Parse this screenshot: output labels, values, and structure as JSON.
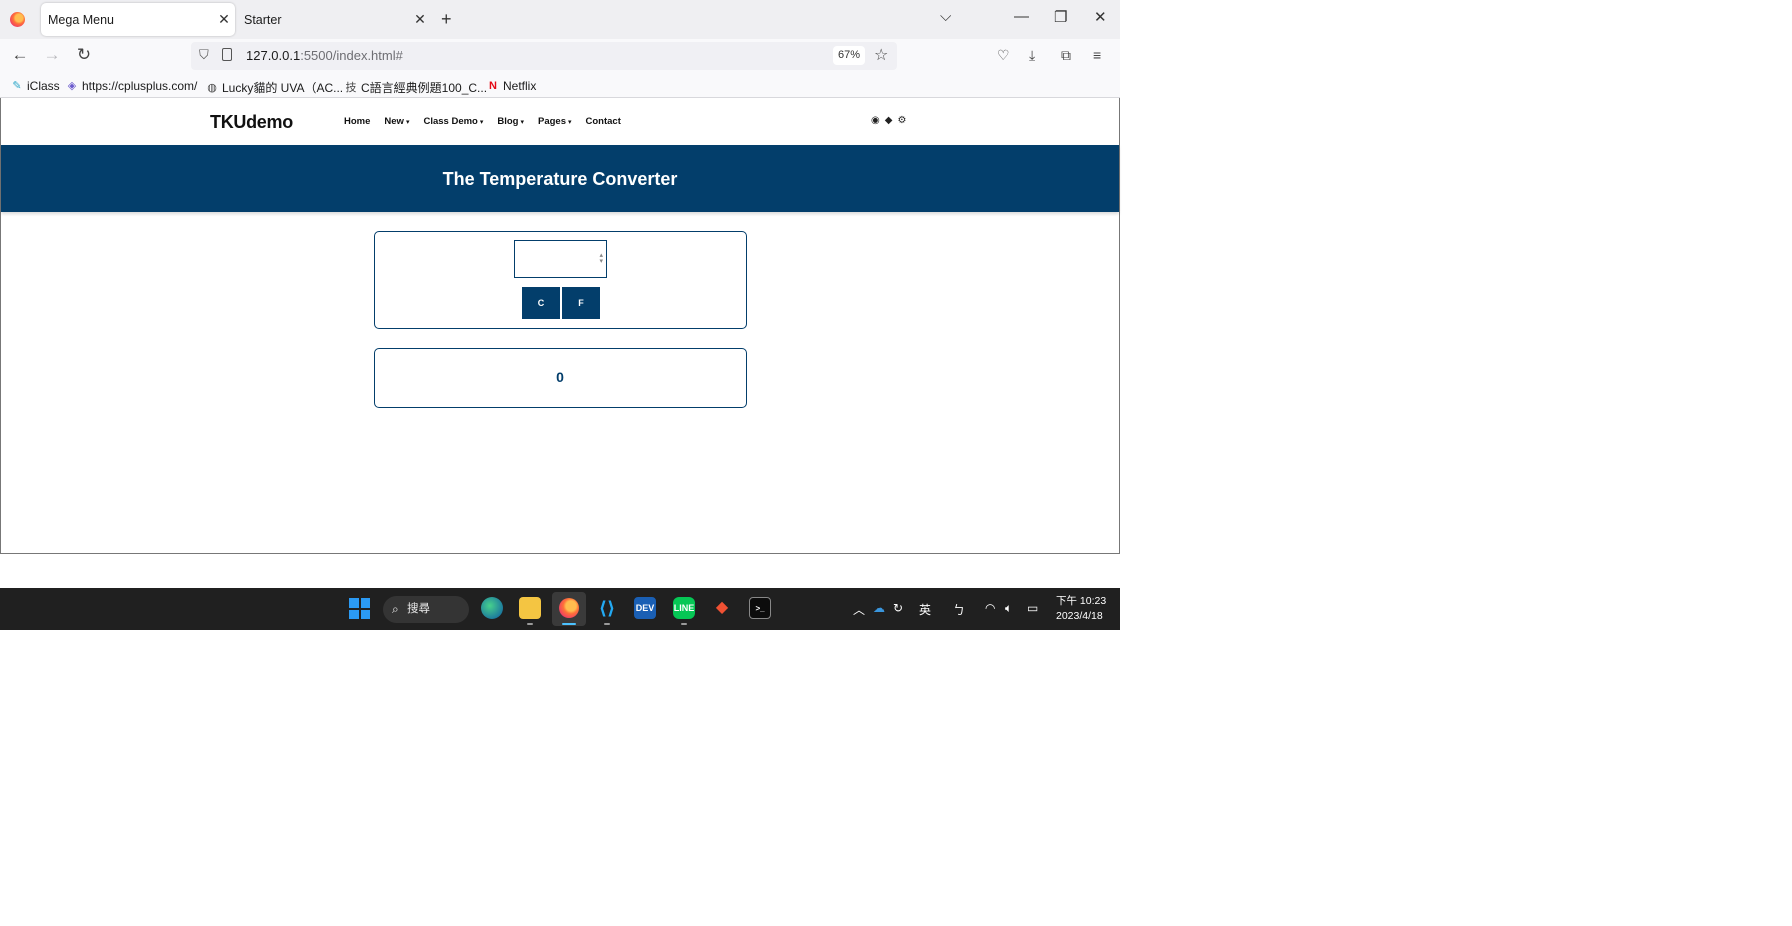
{
  "browser": {
    "tabs": [
      {
        "title": "Mega Menu",
        "active": true
      },
      {
        "title": "Starter",
        "active": false
      }
    ],
    "url_host": "127.0.0.1",
    "url_path": ":5500/index.html#",
    "zoom": "67%",
    "bookmarks": [
      {
        "label": "iClass",
        "icon": "iclass-icon"
      },
      {
        "label": "https://cplusplus.com/",
        "icon": "cplusplus-icon"
      },
      {
        "label": "Lucky貓的 UVA（AC...",
        "icon": "globe-icon"
      },
      {
        "label": "C語言經典例題100_C...",
        "icon": "site-icon"
      },
      {
        "label": "Netflix",
        "icon": "netflix-icon"
      }
    ]
  },
  "site": {
    "brand": "TKUdemo",
    "menu": [
      {
        "label": "Home",
        "has_dropdown": false
      },
      {
        "label": "New",
        "has_dropdown": true
      },
      {
        "label": "Class Demo",
        "has_dropdown": true
      },
      {
        "label": "Blog",
        "has_dropdown": true
      },
      {
        "label": "Pages",
        "has_dropdown": true
      },
      {
        "label": "Contact",
        "has_dropdown": false
      }
    ],
    "header_icons": [
      "github-icon",
      "diamond-icon",
      "gear-icon"
    ],
    "banner_title": "The Temperature Converter",
    "colors": {
      "primary": "#033e6b",
      "text_on_primary": "#ffffff"
    }
  },
  "converter": {
    "input_value": "",
    "button_c": "C",
    "button_f": "F",
    "result": "0"
  },
  "taskbar": {
    "search_label": "搜尋",
    "ime_label": "英",
    "ime_mode": "ㄅ",
    "time": "下午 10:23",
    "date": "2023/4/18",
    "apps": [
      "edge-icon",
      "file-explorer-icon",
      "firefox-icon",
      "vscode-icon",
      "devcpp-icon",
      "line-icon",
      "git-icon",
      "terminal-icon"
    ]
  }
}
